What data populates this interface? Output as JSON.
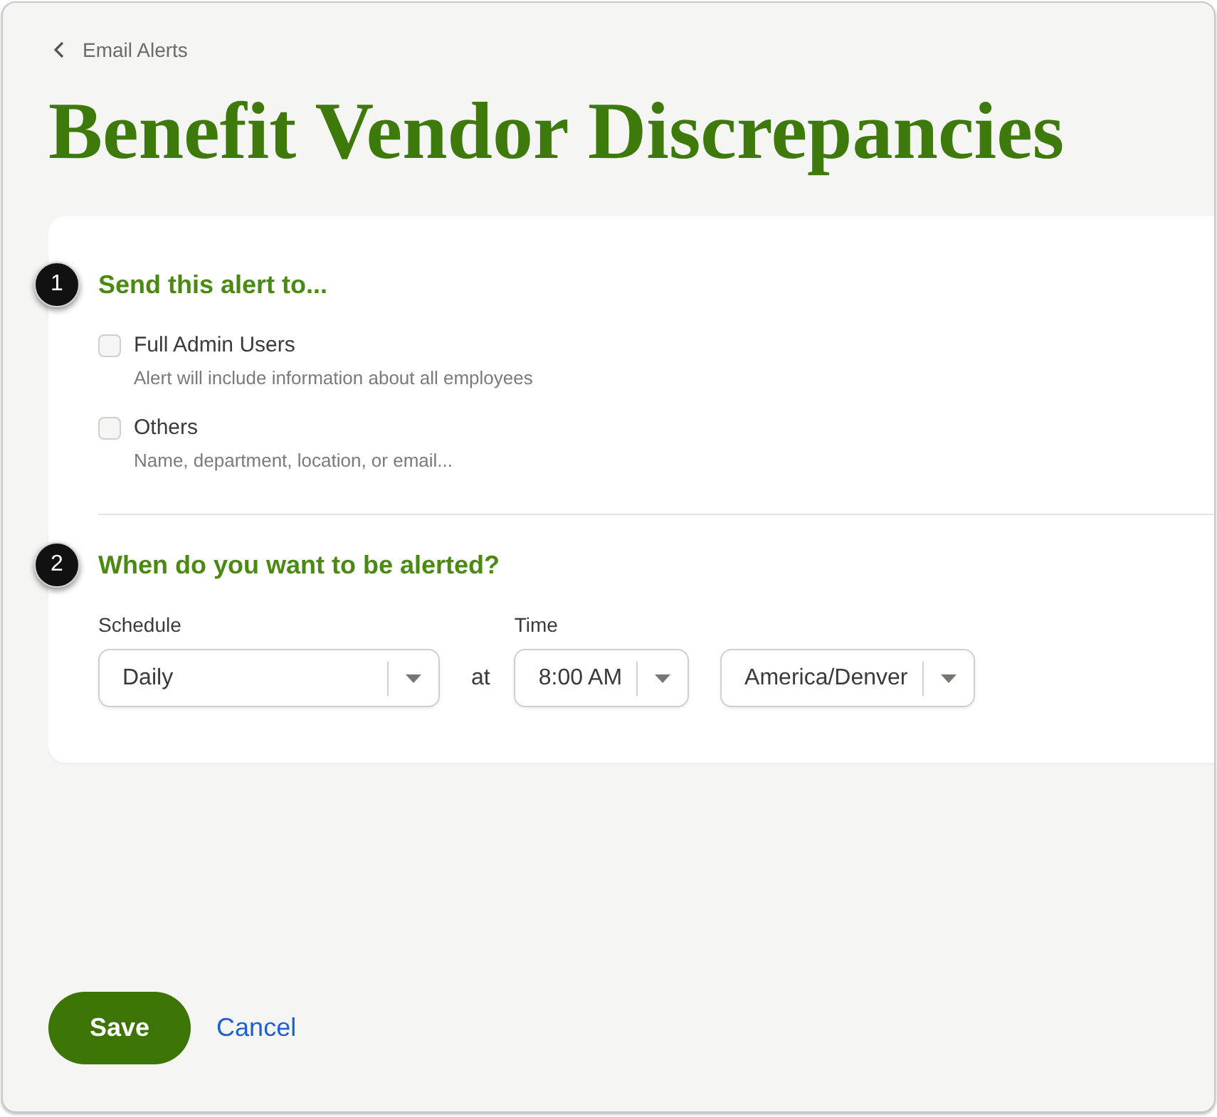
{
  "breadcrumb": {
    "label": "Email Alerts"
  },
  "title": "Benefit Vendor Discrepancies",
  "sections": [
    {
      "step": "1",
      "heading": "Send this alert to...",
      "kind": "recipients",
      "options": [
        {
          "label": "Full Admin Users",
          "description": "Alert will include information about all employees",
          "checked": false
        },
        {
          "label": "Others",
          "description": "Name, department, location, or email...",
          "checked": false
        }
      ]
    },
    {
      "step": "2",
      "heading": "When do you want to be alerted?",
      "kind": "schedule",
      "fields": [
        {
          "kind": "select",
          "label": "Schedule",
          "value": "Daily"
        },
        {
          "kind": "connector",
          "text": "at"
        },
        {
          "kind": "select",
          "label": "Time",
          "value": "8:00 AM"
        },
        {
          "kind": "select",
          "value": "America/Denver"
        }
      ]
    }
  ],
  "actions": [
    {
      "kind": "primary",
      "label": "Save"
    },
    {
      "kind": "link",
      "label": "Cancel"
    }
  ]
}
